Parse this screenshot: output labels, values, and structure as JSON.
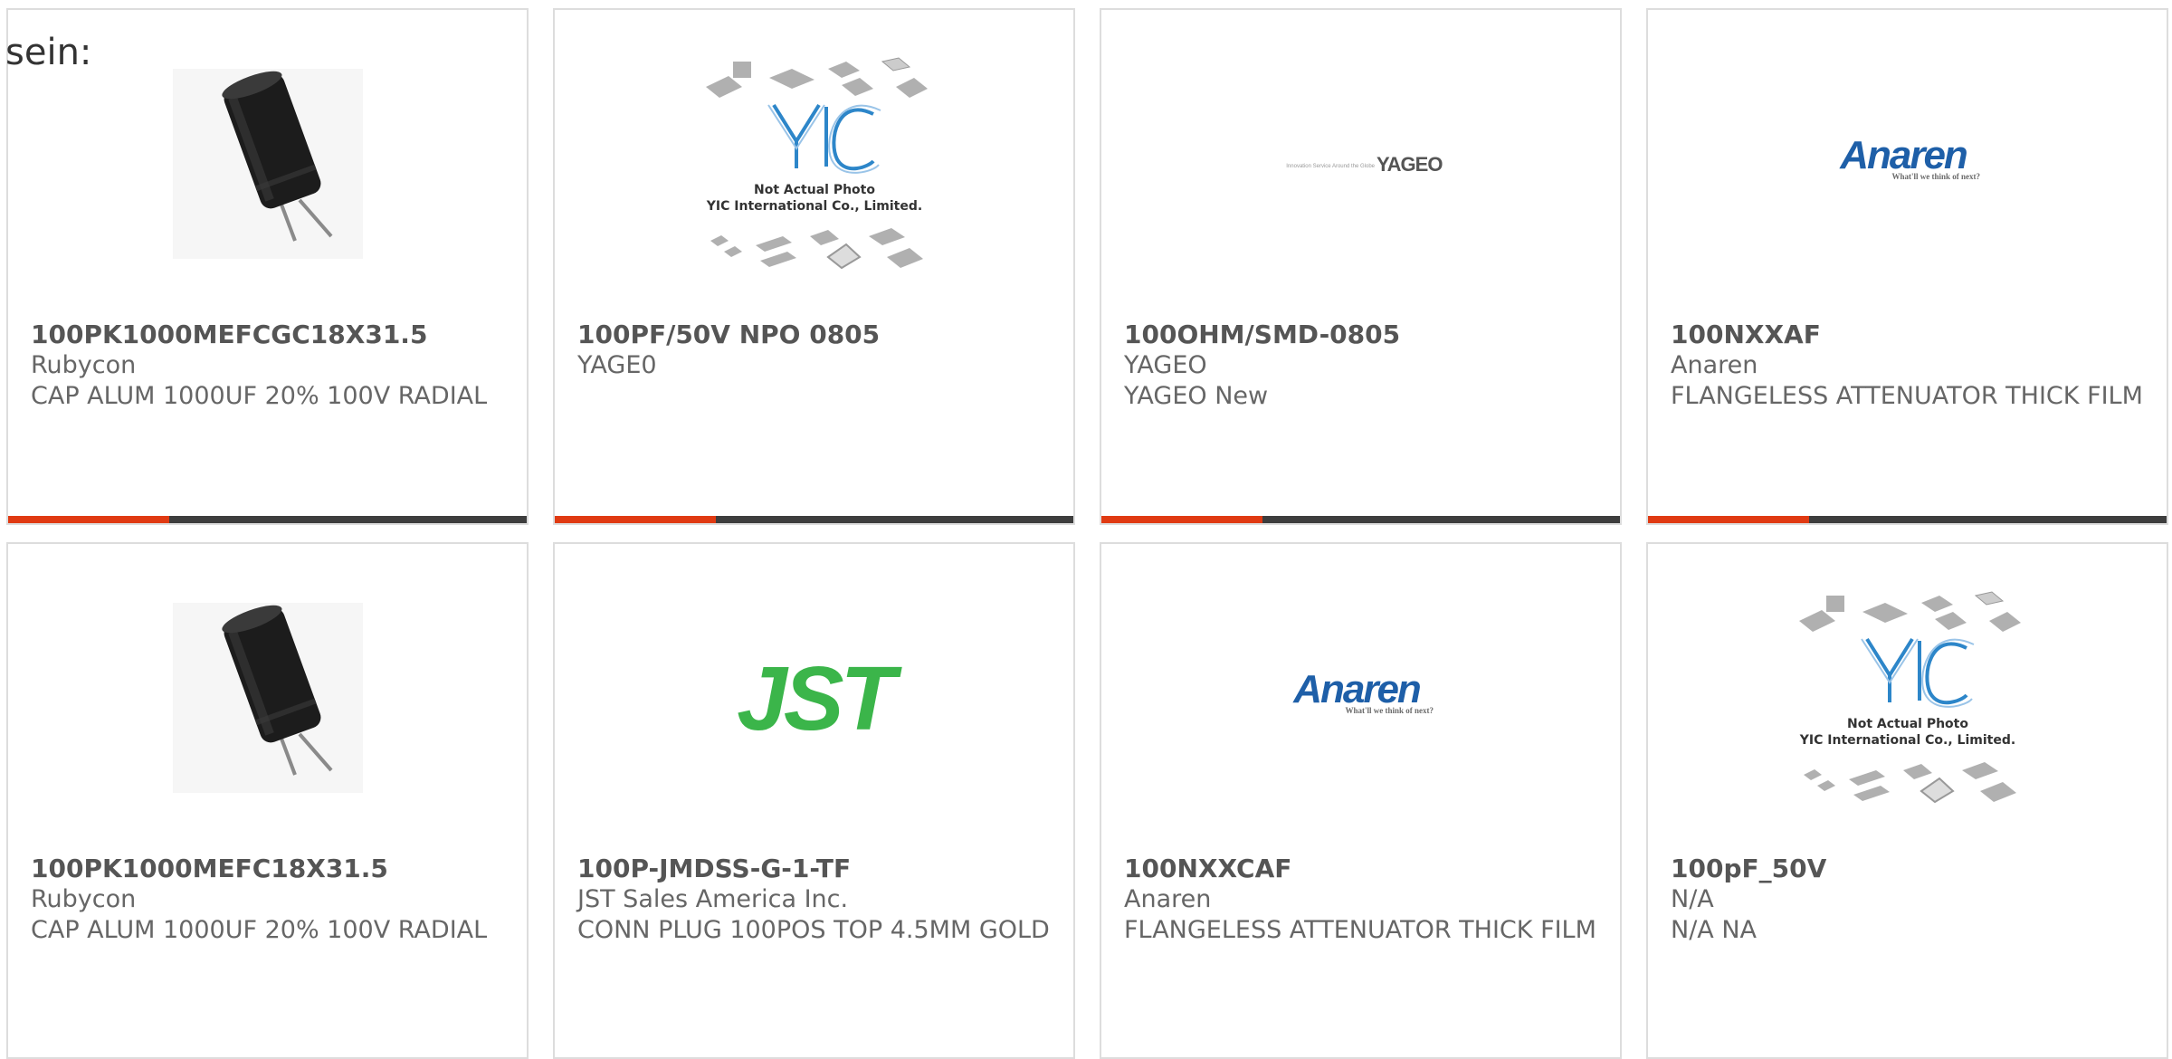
{
  "page": {
    "label": "sein:"
  },
  "colors": {
    "accent": "#e03a12",
    "bar": "#3d3d3d",
    "border": "#dddddd",
    "text": "#666666",
    "anaren_blue": "#1e5fa8",
    "jst_green": "#3bb54a",
    "yic_blue": "#2d86c9"
  },
  "products": [
    {
      "part_number": "100PK1000MEFCGC18X31.5",
      "manufacturer": "Rubycon",
      "description": "CAP ALUM 1000UF 20% 100V RADIAL",
      "image": "electrolytic-capacitor-icon"
    },
    {
      "part_number": "100PF/50V NPO 0805",
      "manufacturer": "YAGE0",
      "description": "",
      "image": "yic-placeholder-logo",
      "image_caption_1": "Not Actual Photo",
      "image_caption_2": "YIC International Co., Limited."
    },
    {
      "part_number": "100OHM/SMD-0805",
      "manufacturer": "YAGEO",
      "description": "YAGEO New",
      "image": "yageo-logo",
      "logo_tagline": "Innovation Service Around the Globe",
      "logo_text": "YAGEO"
    },
    {
      "part_number": "100NXXAF",
      "manufacturer": "Anaren",
      "description": "FLANGELESS ATTENUATOR THICK FILM",
      "image": "anaren-logo",
      "logo_text": "Anaren",
      "logo_tagline": "What'll we think of next?"
    },
    {
      "part_number": "100PK1000MEFC18X31.5",
      "manufacturer": "Rubycon",
      "description": "CAP ALUM 1000UF 20% 100V RADIAL",
      "image": "electrolytic-capacitor-icon"
    },
    {
      "part_number": "100P-JMDSS-G-1-TF",
      "manufacturer": "JST Sales America Inc.",
      "description": "CONN PLUG 100POS TOP 4.5MM GOLD",
      "image": "jst-logo",
      "logo_text": "JST"
    },
    {
      "part_number": "100NXXCAF",
      "manufacturer": "Anaren",
      "description": "FLANGELESS ATTENUATOR THICK FILM",
      "image": "anaren-logo",
      "logo_text": "Anaren",
      "logo_tagline": "What'll we think of next?"
    },
    {
      "part_number": "100pF_50V",
      "manufacturer": "N/A",
      "description": "N/A NA",
      "image": "yic-placeholder-logo",
      "image_caption_1": "Not Actual Photo",
      "image_caption_2": "YIC International Co., Limited."
    }
  ]
}
